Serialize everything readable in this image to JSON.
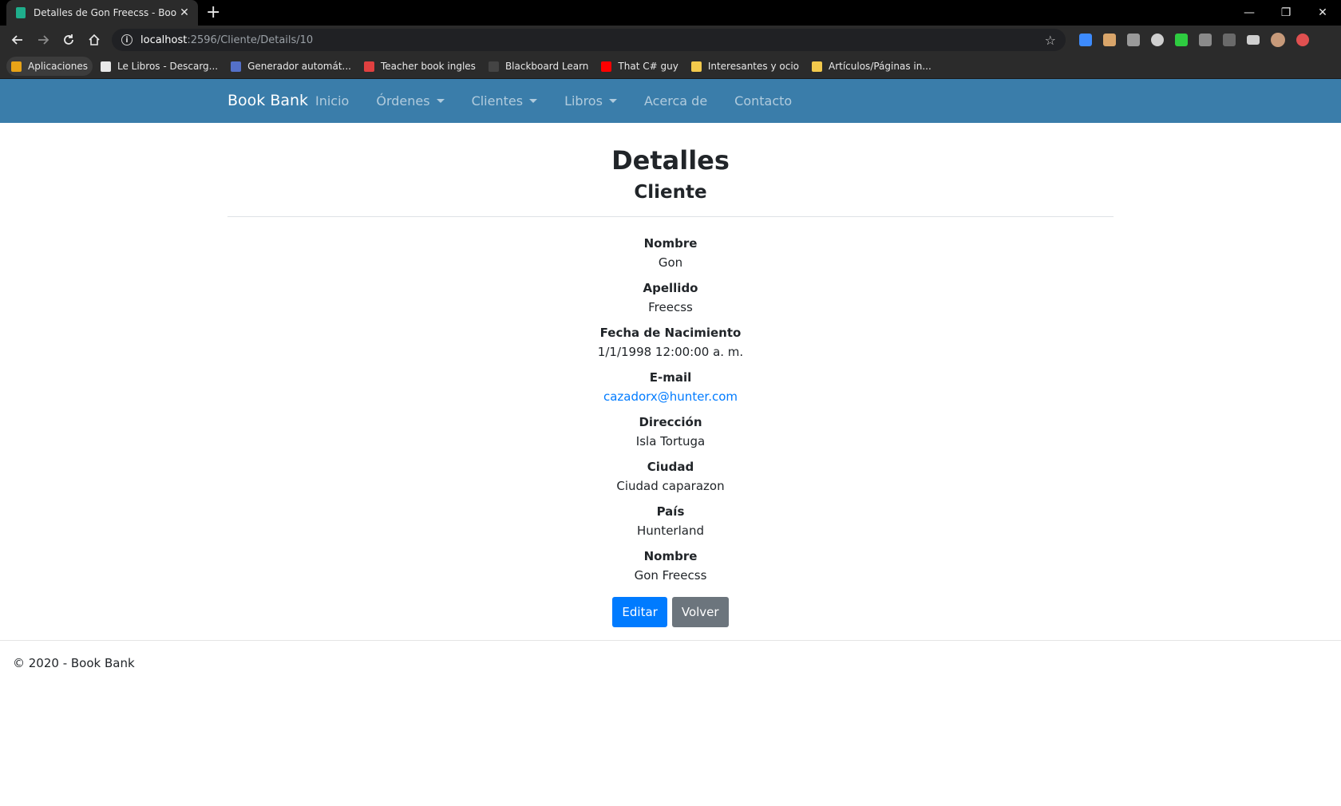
{
  "browser": {
    "tab_title": "Detalles de Gon Freecss - Book B",
    "url_host": "localhost",
    "url_path": ":2596/Cliente/Details/10",
    "bookmarks": [
      {
        "label": "Aplicaciones",
        "color": "#e8a317"
      },
      {
        "label": "Le Libros - Descarg...",
        "color": "#e8e8e8"
      },
      {
        "label": "Generador automát...",
        "color": "#5470c8"
      },
      {
        "label": "Teacher book ingles",
        "color": "#e04040"
      },
      {
        "label": "Blackboard Learn",
        "color": "#444444"
      },
      {
        "label": "That C# guy",
        "color": "#ff0000"
      },
      {
        "label": "Interesantes y ocio",
        "color": "#f2c94c"
      },
      {
        "label": "Artículos/Páginas in...",
        "color": "#f2c94c"
      }
    ]
  },
  "nav": {
    "brand": "Book Bank",
    "links": [
      "Inicio",
      "Órdenes",
      "Clientes",
      "Libros",
      "Acerca de",
      "Contacto"
    ]
  },
  "page": {
    "title": "Detalles",
    "subtitle": "Cliente",
    "fields": [
      {
        "label": "Nombre",
        "value": "Gon"
      },
      {
        "label": "Apellido",
        "value": "Freecss"
      },
      {
        "label": "Fecha de Nacimiento",
        "value": "1/1/1998 12:00:00 a. m."
      },
      {
        "label": "E-mail",
        "value": "cazadorx@hunter.com"
      },
      {
        "label": "Dirección",
        "value": "Isla Tortuga"
      },
      {
        "label": "Ciudad",
        "value": "Ciudad caparazon"
      },
      {
        "label": "País",
        "value": "Hunterland"
      },
      {
        "label": "Nombre",
        "value": "Gon Freecss"
      }
    ],
    "edit_label": "Editar",
    "back_label": "Volver"
  },
  "footer": {
    "text": "© 2020 - Book Bank"
  }
}
